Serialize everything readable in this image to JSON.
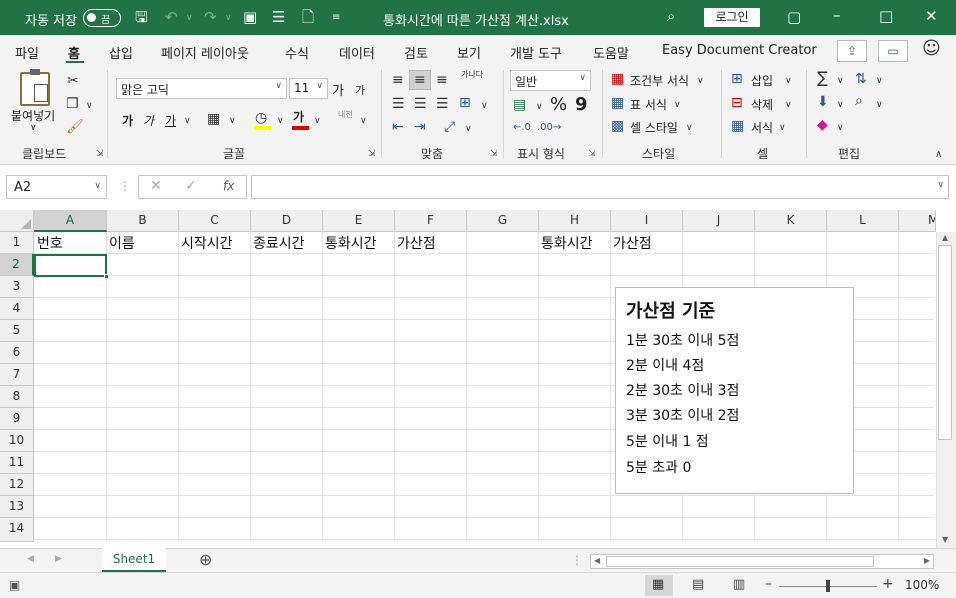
{
  "titlebar": {
    "autosave_label": "자동 저장",
    "autosave_state": "끔",
    "filename": "통화시간에 따른 가산점 계산.xlsx",
    "login": "로그인"
  },
  "tabs": [
    "파일",
    "홈",
    "삽입",
    "페이지 레이아웃",
    "수식",
    "데이터",
    "검토",
    "보기",
    "개발 도구",
    "도움말",
    "Easy Document Creator"
  ],
  "active_tab": "홈",
  "ribbon": {
    "clipboard": {
      "paste": "붙여넣기",
      "label": "클립보드"
    },
    "font": {
      "name": "맑은 고딕",
      "size": "11",
      "grow": "가",
      "shrink": "가",
      "bold": "가",
      "italic": "가",
      "underline": "가",
      "color_letter": "가",
      "label": "글꼴",
      "phonetic": "내천"
    },
    "alignment": {
      "wrap": "가나다",
      "label": "맞춤"
    },
    "number": {
      "format": "일반",
      "percent": "%",
      "comma": "9",
      "label": "표시 형식"
    },
    "styles": {
      "conditional": "조건부 서식",
      "table": "표 서식",
      "cell": "셀 스타일",
      "label": "스타일"
    },
    "cells": {
      "insert": "삽입",
      "delete": "삭제",
      "format": "서식",
      "label": "셀"
    },
    "editing": {
      "label": "편집"
    }
  },
  "formula_bar": {
    "name_box": "A2",
    "fx": "fx",
    "value": ""
  },
  "columns": [
    "A",
    "B",
    "C",
    "D",
    "E",
    "F",
    "G",
    "H",
    "I",
    "J",
    "K",
    "L",
    "M"
  ],
  "selected_column": "A",
  "rows": [
    "1",
    "2",
    "3",
    "4",
    "5",
    "6",
    "7",
    "8",
    "9",
    "10",
    "11",
    "12",
    "13",
    "14"
  ],
  "selected_row": "2",
  "row1": {
    "A": "번호",
    "B": "이름",
    "C": "시작시간",
    "D": "종료시간",
    "E": "통화시간",
    "F": "가산점",
    "G": "",
    "H": "통화시간",
    "I": "가산점"
  },
  "textbox": {
    "title": "가산점 기준",
    "lines": [
      "1분 30초 이내 5점",
      "2분 이내 4점",
      "2분 30초 이내 3점",
      "3분 30초 이내 2점",
      "5분 이내 1 점",
      "5분 초과 0"
    ]
  },
  "sheet_tab": "Sheet1",
  "status": {
    "zoom": "100%"
  },
  "colors": {
    "accent": "#217346"
  }
}
